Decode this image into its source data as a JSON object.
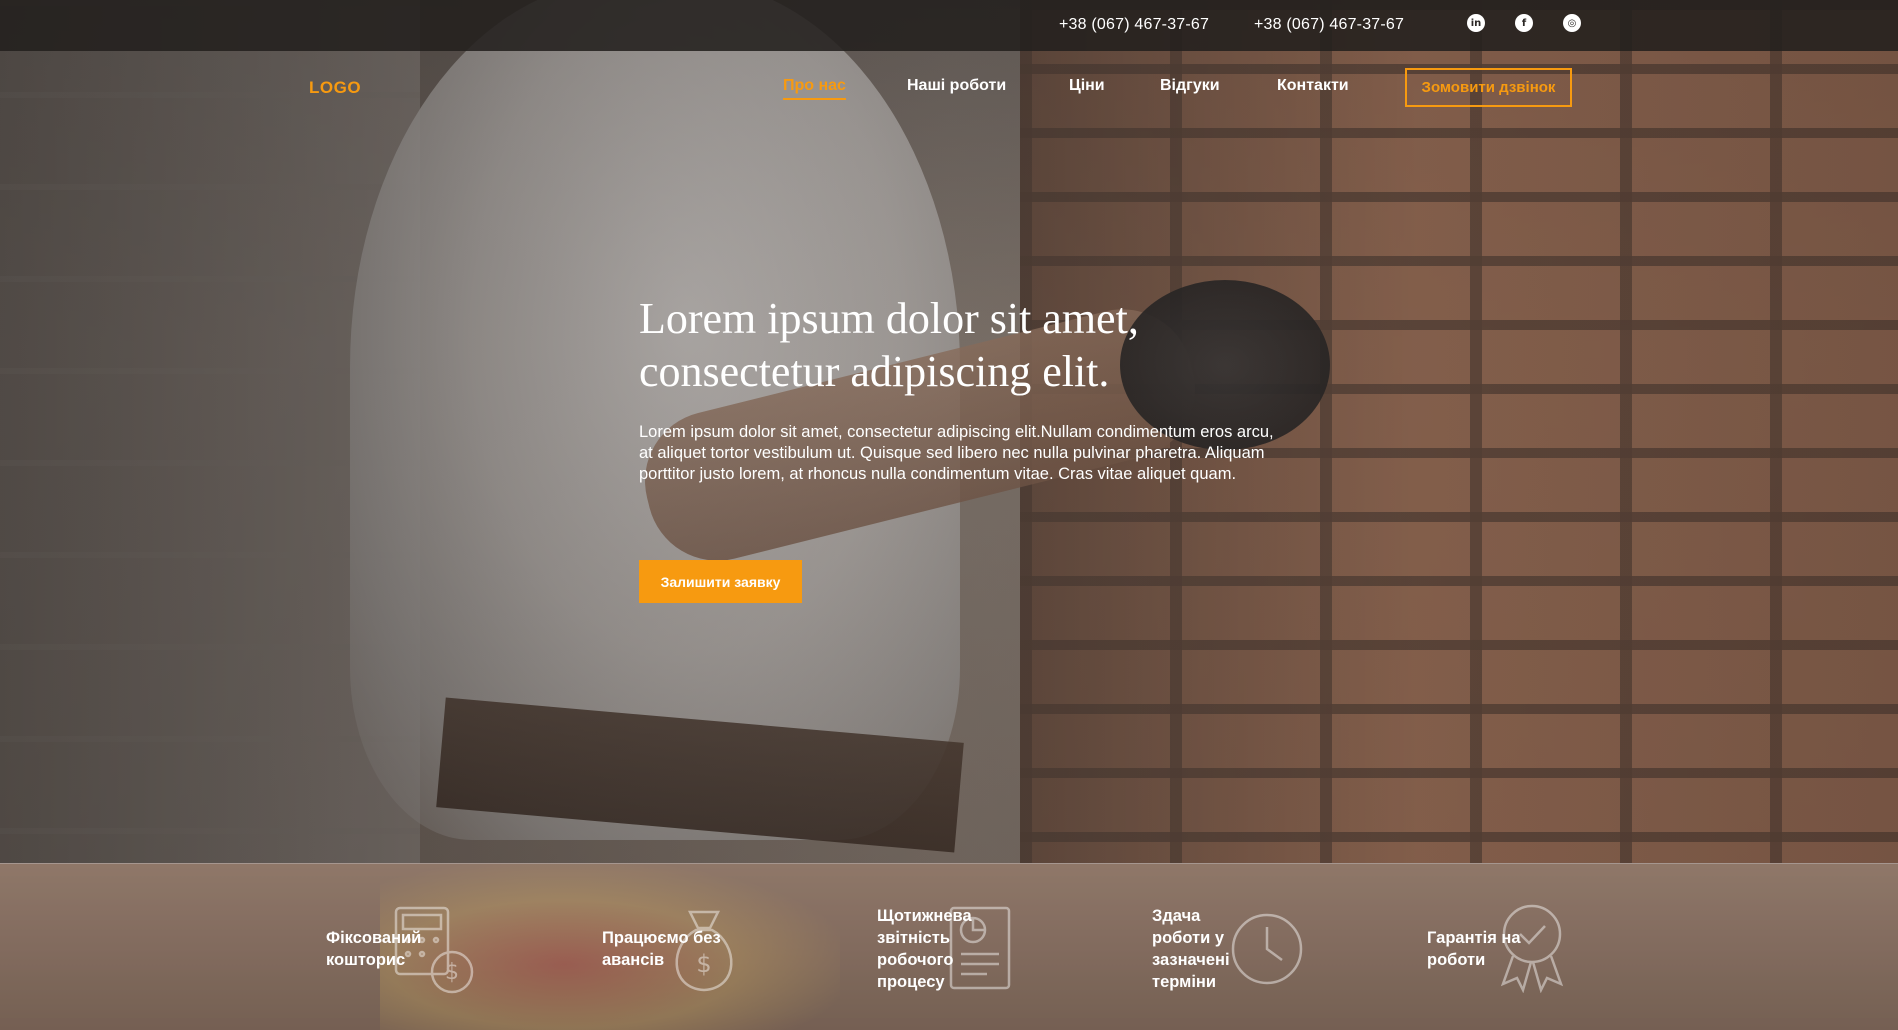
{
  "topbar": {
    "phones": [
      "+38 (067) 467-37-67",
      "+38 (067) 467-37-67"
    ],
    "social": [
      {
        "icon": "linkedin-icon",
        "glyph": "in"
      },
      {
        "icon": "facebook-icon",
        "glyph": "f"
      },
      {
        "icon": "instagram-icon",
        "glyph": "◎"
      }
    ]
  },
  "nav": {
    "logo": "LOGO",
    "items": [
      {
        "label": "Про нас",
        "active": true
      },
      {
        "label": "Наші роботи",
        "active": false
      },
      {
        "label": "Ціни",
        "active": false
      },
      {
        "label": "Відгуки",
        "active": false
      },
      {
        "label": "Контакти",
        "active": false
      }
    ],
    "call_button": "Зомовити дзвінок"
  },
  "hero": {
    "title": "Lorem ipsum dolor sit amet, consectetur adipiscing elit.",
    "text": "Lorem ipsum dolor sit amet, consectetur adipiscing elit.Nullam condimentum eros arcu, at aliquet tortor vestibulum ut. Quisque sed libero nec nulla pulvinar pharetra. Aliquam porttitor justo lorem, at rhoncus nulla condimentum vitae. Cras vitae aliquet quam.",
    "cta": "Залишити заявку"
  },
  "features": [
    {
      "label": "Фіксований кошторис",
      "icon": "calculator-dollar-icon"
    },
    {
      "label": "Працюємо без авансів",
      "icon": "money-bag-icon"
    },
    {
      "label": "Щотижнева звітність робочого процесу",
      "icon": "report-document-icon"
    },
    {
      "label": "Здача роботи у зазначені терміни",
      "icon": "clock-icon"
    },
    {
      "label": "Гарантія на роботи",
      "icon": "award-badge-icon"
    }
  ],
  "colors": {
    "accent": "#f79a10",
    "topbar_bg": "#23201e",
    "text": "#ffffff"
  }
}
